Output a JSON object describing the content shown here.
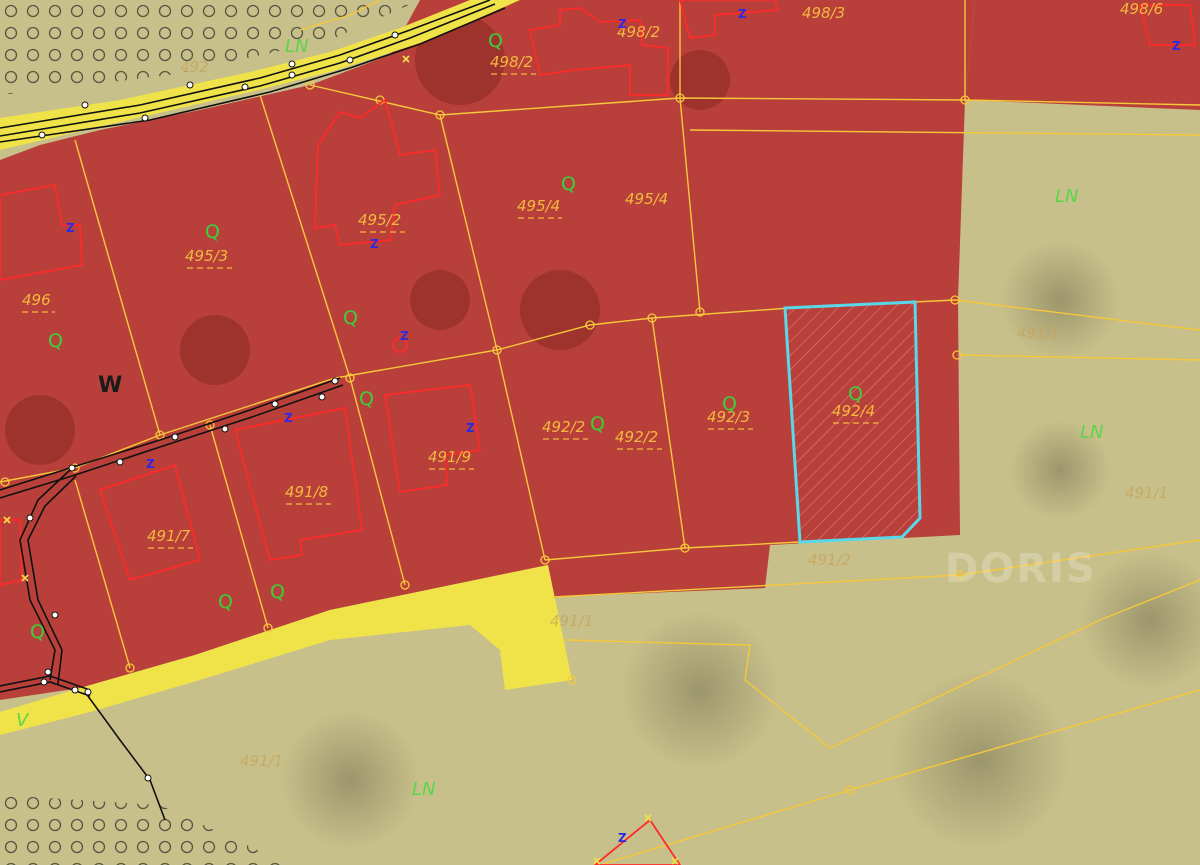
{
  "map": {
    "watermark": "DORIS",
    "zone_labels": [
      {
        "id": "w",
        "text": "W"
      },
      {
        "id": "ln-1",
        "text": "LN"
      },
      {
        "id": "ln-2",
        "text": "LN"
      },
      {
        "id": "ln-3",
        "text": "LN"
      },
      {
        "id": "ln-4",
        "text": "LN"
      },
      {
        "id": "v",
        "text": "V"
      }
    ],
    "parcel_numbers": [
      "498/3",
      "498/6",
      "498/2",
      "498/2",
      "495/2",
      "495/4",
      "495/4",
      "495/3",
      "496",
      "492/2",
      "492/2",
      "492/3",
      "492/4",
      "491/9",
      "491/8",
      "491/7",
      "491/2",
      "491/1",
      "491/1",
      "491/1",
      "491/1",
      "492"
    ],
    "use_code": "Q",
    "house_marker": "Z",
    "colors": {
      "building_zone": "#b9403a",
      "green_zone": "#c8c08a",
      "road": "#f0e34a",
      "parcel_lines": "#f6c83a",
      "selected_parcel": "#58d8e8",
      "buildings": "#ff2a2a",
      "utility_line": "#111111"
    },
    "selected_parcel": "492/4"
  }
}
